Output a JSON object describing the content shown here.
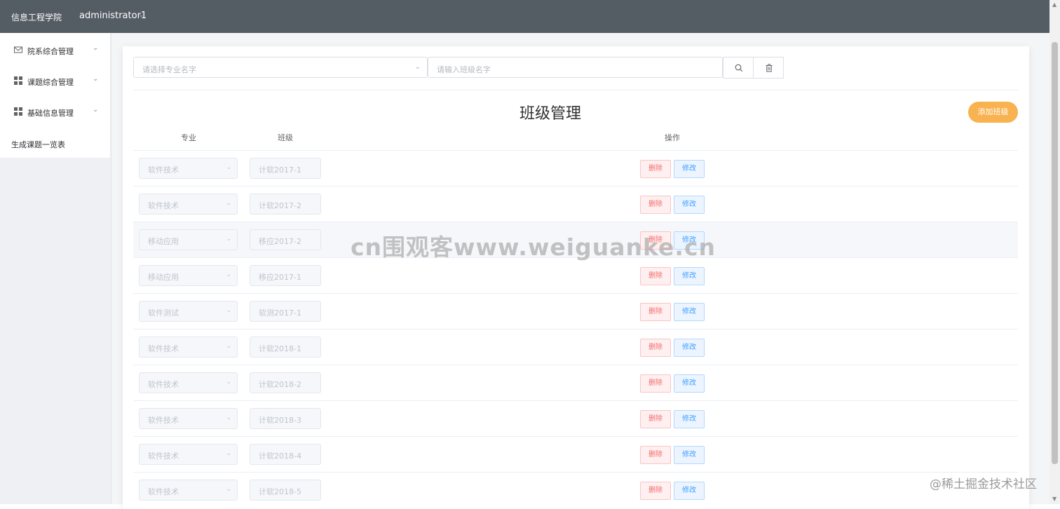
{
  "header": {
    "brand": "信息工程学院",
    "user": "administrator1"
  },
  "sidebar": {
    "items": [
      {
        "label": "院系综合管理",
        "icon": "envelope-icon"
      },
      {
        "label": "课题综合管理",
        "icon": "grid-icon"
      },
      {
        "label": "基础信息管理",
        "icon": "grid-icon"
      }
    ],
    "plain_item": "生成课题一览表"
  },
  "filters": {
    "major_placeholder": "请选择专业名字",
    "class_placeholder": "请输入班级名字"
  },
  "page_title": "班级管理",
  "add_button": "添加班级",
  "table": {
    "columns": {
      "major": "专业",
      "class": "班级",
      "actions": "操作"
    },
    "delete_label": "删除",
    "edit_label": "修改",
    "rows": [
      {
        "major": "软件技术",
        "class": "计软2017-1"
      },
      {
        "major": "软件技术",
        "class": "计软2017-2"
      },
      {
        "major": "移动应用",
        "class": "移应2017-2"
      },
      {
        "major": "移动应用",
        "class": "移应2017-1"
      },
      {
        "major": "软件测试",
        "class": "软测2017-1"
      },
      {
        "major": "软件技术",
        "class": "计软2018-1"
      },
      {
        "major": "软件技术",
        "class": "计软2018-2"
      },
      {
        "major": "软件技术",
        "class": "计软2018-3"
      },
      {
        "major": "软件技术",
        "class": "计软2018-4"
      },
      {
        "major": "软件技术",
        "class": "计软2018-5"
      }
    ]
  },
  "watermarks": {
    "center": "cn围观客www.weiguanke.cn",
    "corner": "@稀土掘金技术社区"
  },
  "colors": {
    "header_bg": "#545c64",
    "accent": "#f8b24f",
    "danger": "#f56c6c",
    "primary": "#409eff"
  }
}
